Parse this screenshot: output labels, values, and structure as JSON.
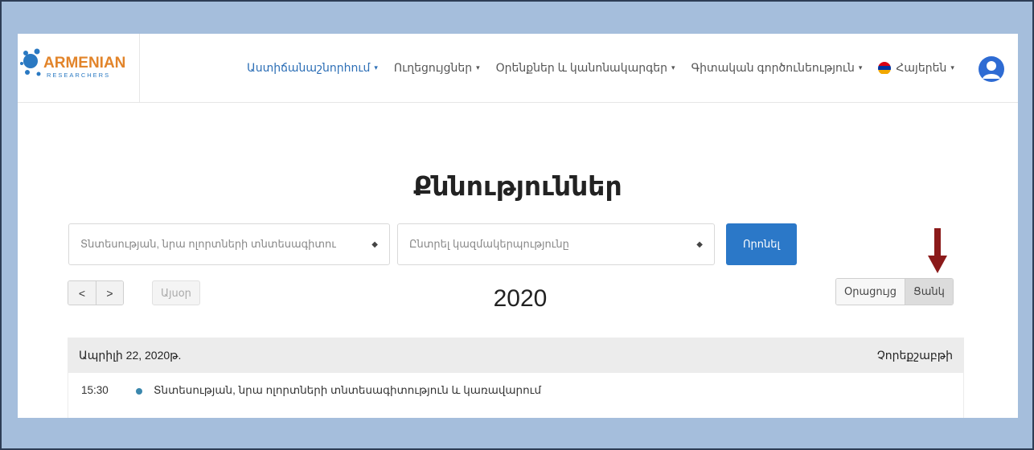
{
  "logo": {
    "text_main": "ARMENIAN",
    "text_sub": "RESEARCHERS"
  },
  "nav": {
    "items": [
      {
        "label": "Աստիճանաշնորհում",
        "active": true
      },
      {
        "label": "Ուղեցույցներ",
        "active": false
      },
      {
        "label": "Օրենքներ և կանոնակարգեր",
        "active": false
      },
      {
        "label": "Գիտական գործունեություն",
        "active": false
      }
    ],
    "language": "Հայերեն",
    "chevron": "⌄"
  },
  "page": {
    "title": "Քննություններ"
  },
  "filters": {
    "discipline_select": "Տնտեսության, նրա ոլորտների տնտեսագիտու",
    "organization_select": "Ընտրել կազմակերպությունը",
    "search_button": "Որոնել",
    "select_arrows": "⇕"
  },
  "calendar": {
    "prev": "<",
    "next": ">",
    "today": "Այսօր",
    "year": "2020",
    "view_calendar": "Օրացույց",
    "view_list": "Ցանկ"
  },
  "list": {
    "date": "Ապրիլի 22, 2020թ.",
    "weekday": "Չորեքշաբթի",
    "events": [
      {
        "time": "15:30",
        "title": "Տնտեսության, նրա ոլորտների տնտեսագիտություն և կառավարում"
      }
    ]
  },
  "colors": {
    "accent": "#2b78c8",
    "marker": "#8b1a1a",
    "background": "#a5bedc"
  }
}
